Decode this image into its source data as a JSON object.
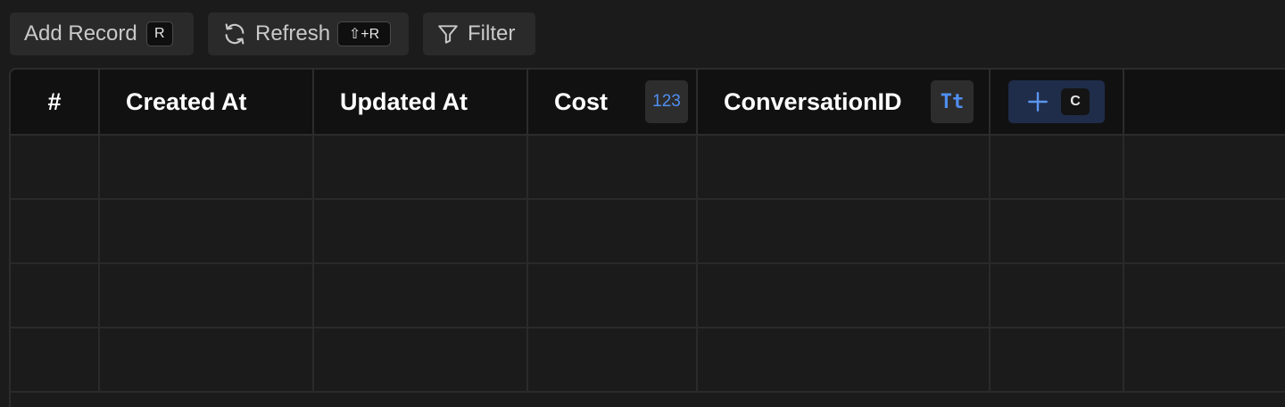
{
  "toolbar": {
    "add_record": {
      "label": "Add Record",
      "shortcut": "R",
      "icon": "none"
    },
    "refresh": {
      "label": "Refresh",
      "shortcut": "⇧+R",
      "icon": "refresh-icon"
    },
    "filter": {
      "label": "Filter",
      "icon": "filter-icon"
    }
  },
  "table": {
    "columns": [
      {
        "label": "#",
        "type_badge": ""
      },
      {
        "label": "Created At",
        "type_badge": ""
      },
      {
        "label": "Updated At",
        "type_badge": ""
      },
      {
        "label": "Cost",
        "type_badge": "123"
      },
      {
        "label": "ConversationID",
        "type_badge": "Tt"
      }
    ],
    "add_column": {
      "icon": "plus-icon",
      "shortcut": "C"
    },
    "rows": [
      [
        "",
        "",
        "",
        "",
        ""
      ],
      [
        "",
        "",
        "",
        "",
        ""
      ],
      [
        "",
        "",
        "",
        "",
        ""
      ],
      [
        "",
        "",
        "",
        "",
        ""
      ]
    ]
  },
  "colors": {
    "background": "#1b1b1b",
    "header_background": "#111111",
    "button_background": "#2a2a2a",
    "accent": "#4f8ff0",
    "add_column_background": "#1f2d4a"
  }
}
